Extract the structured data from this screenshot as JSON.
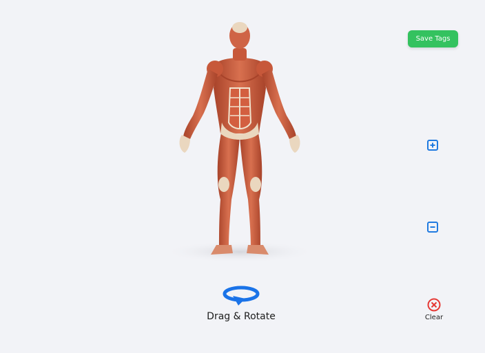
{
  "toolbar": {
    "save_label": "Save Tags",
    "zoom_in_icon": "plus-square-icon",
    "zoom_out_icon": "minus-square-icon"
  },
  "rotate": {
    "label": "Drag & Rotate",
    "icon": "rotate-arrow-icon"
  },
  "clear": {
    "label": "Clear",
    "icon": "close-circle-icon"
  },
  "colors": {
    "background": "#f2f3f7",
    "save_button": "#34c25f",
    "zoom_icons": "#1f7ae0",
    "rotate_icon": "#1a73e8",
    "clear_icon": "#e53935",
    "muscle": "#c7583a",
    "tendon": "#f1e4cf"
  }
}
